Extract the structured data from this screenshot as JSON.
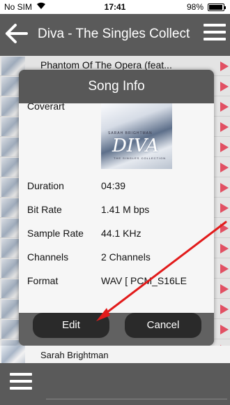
{
  "status": {
    "carrier": "No SIM",
    "time": "17:41",
    "battery": "98%"
  },
  "navbar": {
    "title": "Diva - The Singles Collect"
  },
  "list": {
    "rows": [
      {
        "text": "Phantom Of The Opera (feat..."
      },
      {
        "text": ""
      },
      {
        "text": ""
      },
      {
        "text": ""
      },
      {
        "text": ""
      },
      {
        "text": ""
      },
      {
        "text": ""
      },
      {
        "text": ""
      },
      {
        "text": ""
      },
      {
        "text": ""
      },
      {
        "text": ""
      },
      {
        "text": ""
      },
      {
        "text": ""
      },
      {
        "text": ""
      },
      {
        "text": ""
      }
    ],
    "last_row": "Sarah Brightman"
  },
  "dialog": {
    "title": "Song Info",
    "coverart_label": "Coverart",
    "cover_text": {
      "artist": "SARAH BRIGHTMAN",
      "album": "DIVA",
      "subtitle": "THE SINGLES COLLECTION"
    },
    "fields": [
      {
        "label": "Duration",
        "value": "04:39"
      },
      {
        "label": "Bit Rate",
        "value": "1.41 M bps"
      },
      {
        "label": "Sample Rate",
        "value": "44.1 KHz"
      },
      {
        "label": "Channels",
        "value": "2 Channels"
      },
      {
        "label": "Format",
        "value": "WAV [ PCM_S16LE"
      }
    ],
    "edit_label": "Edit",
    "cancel_label": "Cancel"
  },
  "icons": {
    "back": "back-arrow-icon",
    "menu": "hamburger-menu-icon",
    "play": "play-triangle-icon",
    "wifi": "wifi-icon",
    "battery": "battery-icon"
  },
  "colors": {
    "bar": "#5a5a5a",
    "dialog": "#616161",
    "button": "#2a2a2a",
    "play_accent": "#f0566a",
    "annotation_arrow": "#e21b1b"
  }
}
